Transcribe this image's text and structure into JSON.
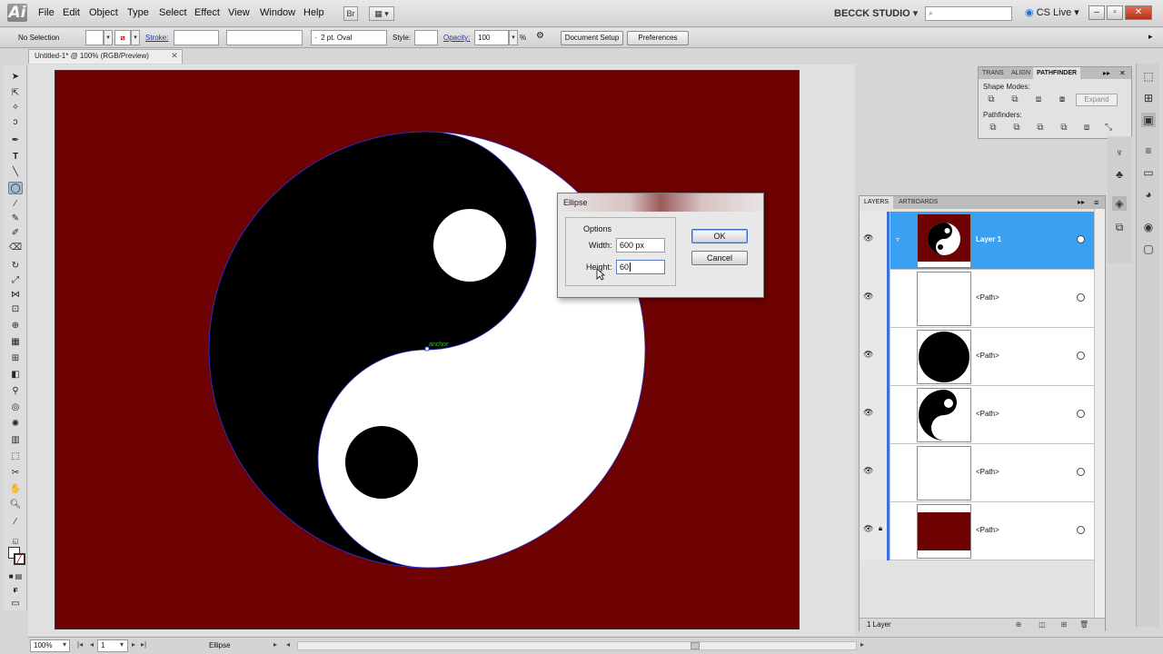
{
  "app": {
    "logo": "Ai",
    "workspace": "BECCK STUDIO",
    "cs_live": "CS Live",
    "bridge_label": "Br"
  },
  "menu": {
    "items": [
      "File",
      "Edit",
      "Object",
      "Type",
      "Select",
      "Effect",
      "View",
      "Window",
      "Help"
    ]
  },
  "control_bar": {
    "selection": "No Selection",
    "stroke_label": "Stroke:",
    "brush": "2 pt. Oval",
    "style_label": "Style:",
    "opacity_label": "Opacity:",
    "opacity_value": "100",
    "opacity_unit": "%",
    "doc_setup": "Document Setup",
    "preferences": "Preferences"
  },
  "document": {
    "tab_title": "Untitled-1* @ 100% (RGB/Preview)"
  },
  "canvas": {
    "artboard_color": "#6e0101",
    "anchor_hint": "anchor"
  },
  "dialog": {
    "title": "Ellipse",
    "group_label": "Options",
    "width_label": "Width:",
    "width_value": "600 px",
    "height_label": "Height:",
    "height_value": "60",
    "ok": "OK",
    "cancel": "Cancel"
  },
  "pathfinder": {
    "tabs": [
      "TRANS",
      "ALIGN",
      "PATHFINDER"
    ],
    "active_tab": "PATHFINDER",
    "shape_modes_label": "Shape Modes:",
    "pathfinders_label": "Pathfinders:",
    "expand": "Expand"
  },
  "layers": {
    "tabs": [
      "LAYERS",
      "ARTBOARDS"
    ],
    "active_tab": "LAYERS",
    "rows": [
      {
        "name": "Layer 1",
        "selected": true
      },
      {
        "name": "<Path>",
        "selected": false
      },
      {
        "name": "<Path>",
        "selected": false
      },
      {
        "name": "<Path>",
        "selected": false
      },
      {
        "name": "<Path>",
        "selected": false
      },
      {
        "name": "<Path>",
        "selected": false
      }
    ],
    "footer": "1 Layer"
  },
  "status_bar": {
    "zoom": "100%",
    "artboard_number": "1",
    "current_tool": "Ellipse"
  },
  "colors": {
    "accent_selection": "#3aa0f1",
    "artboard": "#6e0101"
  }
}
